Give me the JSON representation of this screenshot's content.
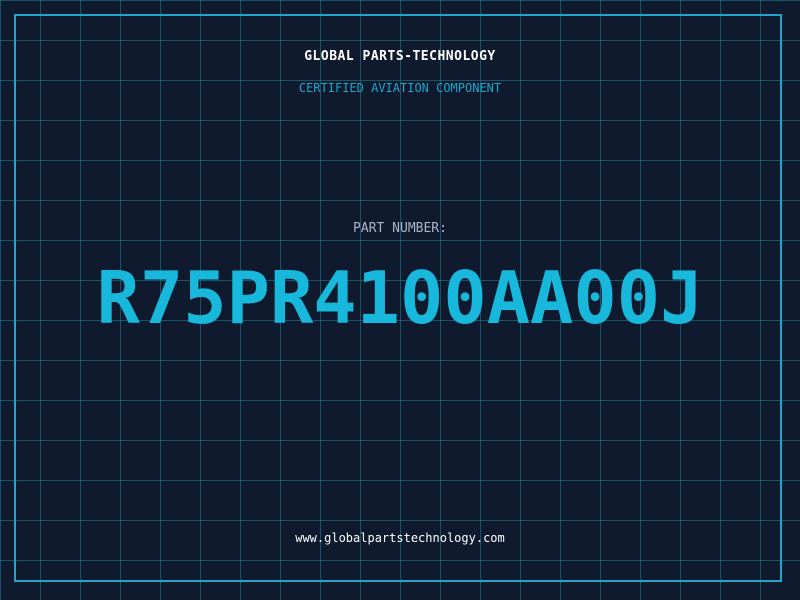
{
  "company": {
    "name": "GLOBAL PARTS-TECHNOLOGY",
    "tagline": "CERTIFIED AVIATION COMPONENT"
  },
  "part": {
    "label": "PART NUMBER:",
    "number": "R75PR4100AA00J"
  },
  "footer": {
    "url": "www.globalpartstechnology.com"
  },
  "colors": {
    "background": "#0f1a2e",
    "accent": "#18b8dc",
    "grid": "#1c8496"
  }
}
